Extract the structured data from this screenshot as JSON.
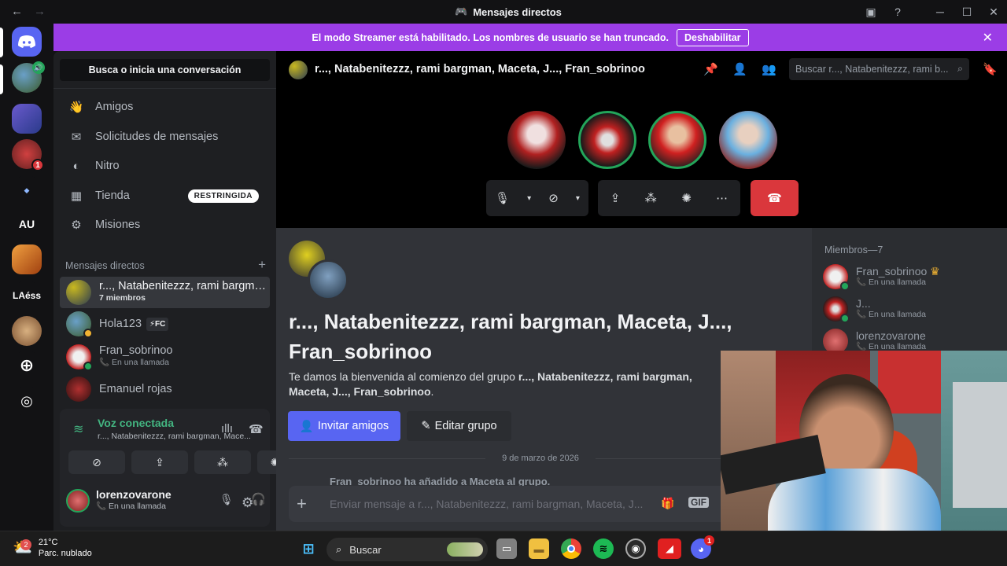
{
  "window": {
    "title": "Mensajes directos"
  },
  "banner": {
    "text": "El modo Streamer está habilitado. Los nombres de usuario se han truncado.",
    "button": "Deshabilitar"
  },
  "servers": {
    "au": "AU",
    "laess": "LAéss",
    "badge": "1"
  },
  "sidebar": {
    "search": "Busca o inicia una conversación",
    "nav": [
      {
        "label": "Amigos",
        "icon": "friends-icon"
      },
      {
        "label": "Solicitudes de mensajes",
        "icon": "envelope-icon"
      },
      {
        "label": "Nitro",
        "icon": "nitro-icon"
      },
      {
        "label": "Tienda",
        "icon": "shop-icon",
        "tag": "RESTRINGIDA"
      },
      {
        "label": "Misiones",
        "icon": "quests-icon"
      }
    ],
    "dm_header": "Mensajes directos",
    "dms": [
      {
        "name": "r..., Natabenitezzz, rami bargman, Ma...",
        "sub": "7 miembros"
      },
      {
        "name": "Hola123",
        "tag": "⚡FC"
      },
      {
        "name": "Fran_sobrinoo",
        "sub": "En una llamada"
      },
      {
        "name": "Emanuel rojas"
      }
    ]
  },
  "voice": {
    "title": "Voz conectada",
    "channel": "r..., Natabenitezzz, rami bargman, Mace..."
  },
  "user": {
    "name": "lorenzovarone",
    "status": "En una llamada"
  },
  "channel": {
    "title": "r..., Natabenitezzz, rami bargman, Maceta, J..., Fran_sobrinoo",
    "search_placeholder": "Buscar r..., Natabenitezzz, rami b..."
  },
  "chat": {
    "big_title": "r..., Natabenitezzz, rami bargman, Maceta, J..., Fran_sobrinoo",
    "welcome_prefix": "Te damos la bienvenida al comienzo del grupo ",
    "welcome_bold": "r..., Natabenitezzz, rami bargman, Maceta, J..., Fran_sobrinoo",
    "welcome_suffix": ".",
    "invite_button": "Invitar amigos",
    "edit_button": "Editar grupo",
    "date": "9 de marzo de 2026",
    "peek": "Fran_sobrinoo ha añadido a Maceta al grupo.",
    "composer_placeholder": "Enviar mensaje a r..., Natabenitezzz, rami bargman, Maceta, J...",
    "gif": "GIF"
  },
  "members": {
    "header": "Miembros—7",
    "list": [
      {
        "name": "Fran_sobrinoo",
        "sub": "En una llamada",
        "crown": "♛"
      },
      {
        "name": "J...",
        "sub": "En una llamada"
      },
      {
        "name": "lorenzovarone",
        "sub": "En una llamada"
      }
    ]
  },
  "taskbar": {
    "temp": "21°C",
    "weather": "Parc. nublado",
    "search": "Buscar",
    "weather_badge": "2",
    "discord_badge": "1"
  },
  "colors": {
    "accent": "#5865f2",
    "banner": "#9b3de6",
    "online": "#23a55a",
    "danger": "#da373c"
  }
}
